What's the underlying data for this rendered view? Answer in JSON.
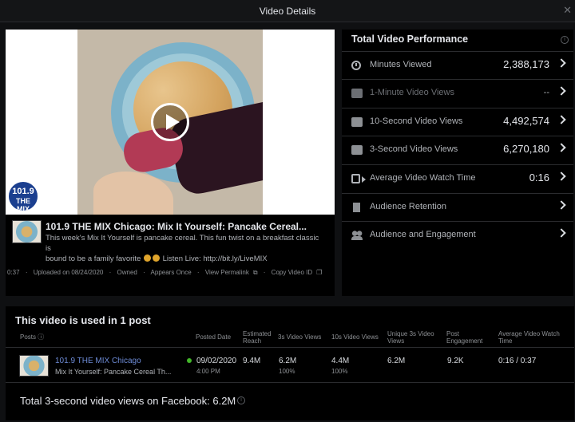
{
  "window": {
    "title": "Video Details",
    "close_glyph": "✕"
  },
  "video": {
    "logo_line1": "101.9",
    "logo_line2": "THE MIX",
    "logo_line3": "CHICAGO",
    "title": "101.9 THE MIX Chicago: Mix It Yourself: Pancake Cereal...",
    "description_1": "This week's Mix It Yourself is pancake cereal. This fun twist on a breakfast classic is",
    "description_2": "bound to be a family favorite",
    "description_3": "Listen Live: http://bit.ly/LiveMIX",
    "meta": {
      "duration": "0:37",
      "uploaded": "Uploaded on 08/24/2020",
      "owned": "Owned",
      "appears": "Appears Once",
      "permalink": "View Permalink",
      "copy_id": "Copy Video ID"
    }
  },
  "performance": {
    "title": "Total Video Performance",
    "rows": [
      {
        "label": "Minutes Viewed",
        "value": "2,388,173",
        "icon": "clock-icon"
      },
      {
        "label": "1-Minute Video Views",
        "value": "--",
        "icon": "video-camera-icon"
      },
      {
        "label": "10-Second Video Views",
        "value": "4,492,574",
        "icon": "video-camera-icon"
      },
      {
        "label": "3-Second Video Views",
        "value": "6,270,180",
        "icon": "video-camera-icon"
      },
      {
        "label": "Average Video Watch Time",
        "value": "0:16",
        "icon": "video-icon"
      },
      {
        "label": "Audience Retention",
        "value": "",
        "icon": "film-strip-icon"
      },
      {
        "label": "Audience and Engagement",
        "value": "",
        "icon": "people-icon"
      }
    ]
  },
  "posts": {
    "title": "This video is used in 1 post",
    "headers": {
      "posts": "Posts",
      "posted_date": "Posted Date",
      "reach_1": "Estimated",
      "reach_2": "Reach",
      "views3s": "3s Video Views",
      "views10s": "10s Video Views",
      "unique_1": "Unique 3s Video",
      "unique_2": "Views",
      "engagement_1": "Post",
      "engagement_2": "Engagement",
      "watch_1": "Average Video Watch",
      "watch_2": "Time"
    },
    "row": {
      "page": "101.9 THE MIX Chicago",
      "desc": "Mix It Yourself: Pancake Cereal Th...",
      "date": "09/02/2020",
      "time": "4:00 PM",
      "reach": "9.4M",
      "views3s": "6.2M",
      "views3s_pct": "100%",
      "views10s": "4.4M",
      "views10s_pct": "100%",
      "unique": "6.2M",
      "engagement": "9.2K",
      "watch": "0:16 / 0:37"
    },
    "total": "Total 3-second video views on Facebook: 6.2M"
  },
  "colors": {
    "accent_link": "#6d8bd6",
    "status_dot": "#42b72a",
    "panel_bg": "#000000"
  }
}
